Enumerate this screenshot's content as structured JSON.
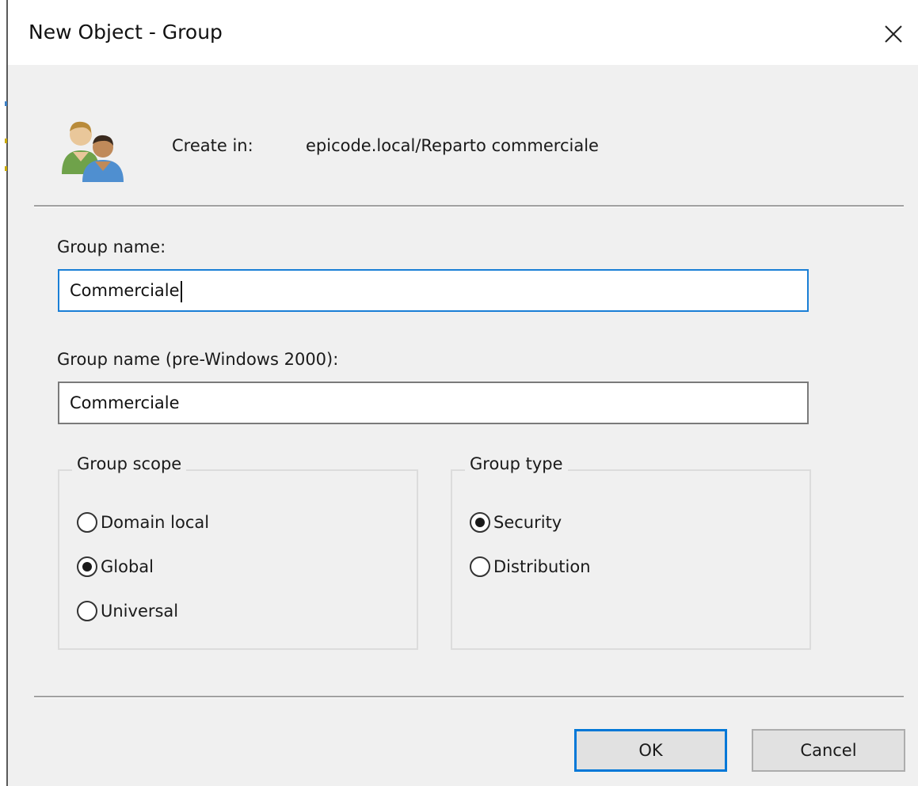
{
  "window": {
    "title": "New Object - Group",
    "close_icon": "close-icon"
  },
  "header": {
    "icon": "user-group-icon",
    "create_in_label": "Create in:",
    "create_in_path": "epicode.local/Reparto commerciale"
  },
  "form": {
    "group_name_label": "Group name:",
    "group_name_value": "Commerciale",
    "pre2000_label": "Group name (pre-Windows 2000):",
    "pre2000_value": "Commerciale"
  },
  "group_scope": {
    "title": "Group scope",
    "options": [
      {
        "label": "Domain local",
        "checked": false
      },
      {
        "label": "Global",
        "checked": true
      },
      {
        "label": "Universal",
        "checked": false
      }
    ]
  },
  "group_type": {
    "title": "Group type",
    "options": [
      {
        "label": "Security",
        "checked": true
      },
      {
        "label": "Distribution",
        "checked": false
      }
    ]
  },
  "buttons": {
    "ok": "OK",
    "cancel": "Cancel"
  },
  "colors": {
    "focus_border": "#1a7fd6",
    "default_button_border": "#0078d7",
    "dialog_background": "#f0f0f0"
  }
}
